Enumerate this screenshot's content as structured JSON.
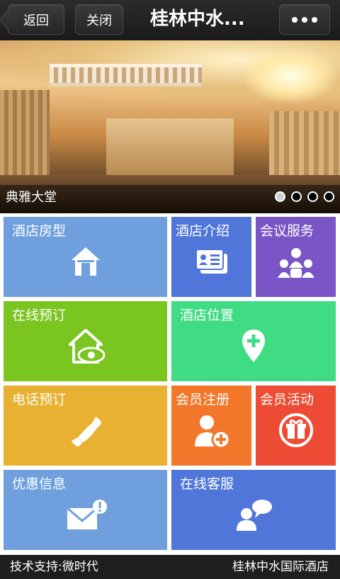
{
  "navbar": {
    "back_label": "返回",
    "close_label": "关闭",
    "title": "桂林中水...",
    "more_icon": "ellipsis-icon"
  },
  "banner": {
    "caption": "典雅大堂",
    "slide_count": 4,
    "active_slide": 1
  },
  "tiles": [
    {
      "label": "酒店房型",
      "icon": "house-icon",
      "color": "#6fa0dd"
    },
    {
      "label": "酒店介绍",
      "icon": "id-card-icon",
      "color": "#4f76d8"
    },
    {
      "label": "会议服务",
      "icon": "group-people-icon",
      "color": "#7a55c6"
    },
    {
      "label": "在线预订",
      "icon": "house-eye-icon",
      "color": "#7ac520"
    },
    {
      "label": "酒店位置",
      "icon": "map-pin-icon",
      "color": "#3fdc84"
    },
    {
      "label": "电话预订",
      "icon": "phone-icon",
      "color": "#e9b131"
    },
    {
      "label": "会员注册",
      "icon": "add-user-icon",
      "color": "#f2772a"
    },
    {
      "label": "会员活动",
      "icon": "gift-icon",
      "color": "#ed4b33"
    },
    {
      "label": "优惠信息",
      "icon": "mail-notification-icon",
      "color": "#6fa0dd"
    },
    {
      "label": "在线客服",
      "icon": "chat-person-icon",
      "color": "#4f76d8"
    }
  ],
  "footer": {
    "left_text": "技术支持:微时代",
    "right_text": "桂林中水国际酒店"
  }
}
